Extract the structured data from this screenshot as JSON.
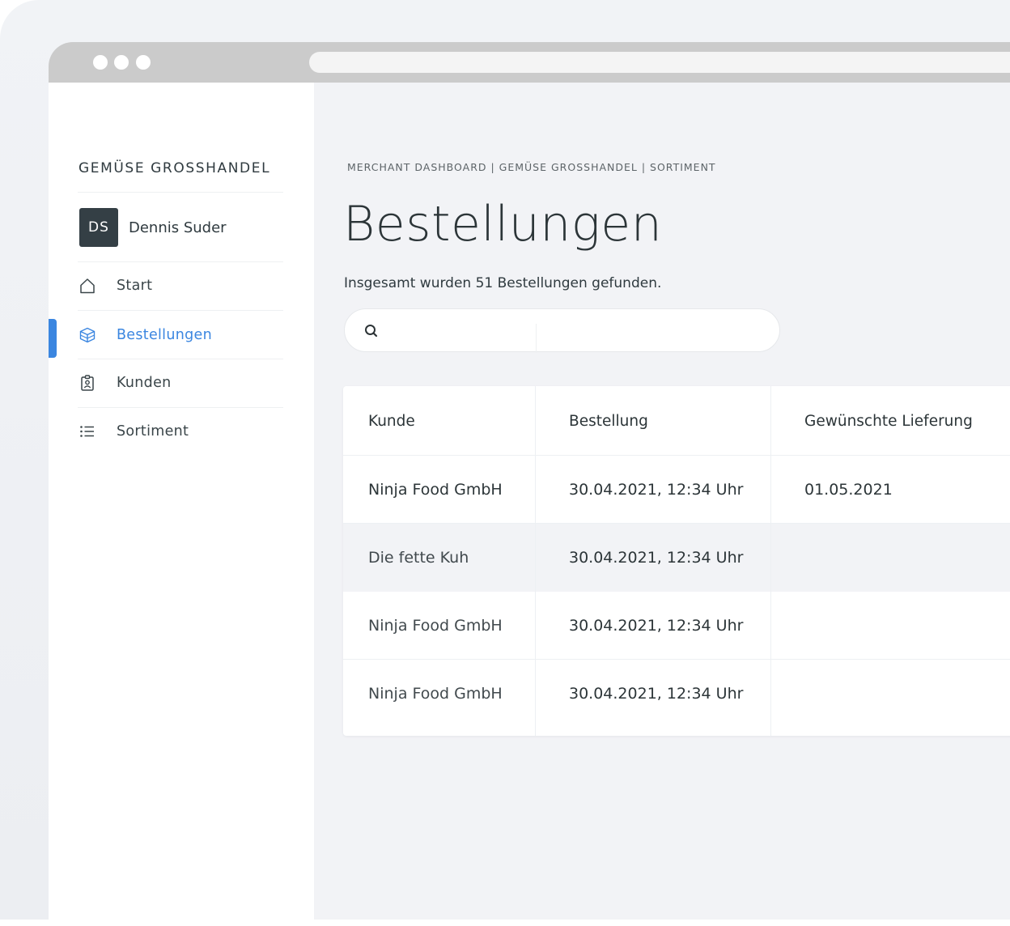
{
  "brand": "GEMÜSE GROSSHANDEL",
  "user": {
    "initials": "DS",
    "name": "Dennis Suder"
  },
  "nav": [
    {
      "label": "Start",
      "icon": "home-icon",
      "active": false
    },
    {
      "label": "Bestellungen",
      "icon": "box-icon",
      "active": true
    },
    {
      "label": "Kunden",
      "icon": "id-badge-icon",
      "active": false
    },
    {
      "label": "Sortiment",
      "icon": "list-icon",
      "active": false
    }
  ],
  "breadcrumb": "MERCHANT DASHBOARD | GEMÜSE GROSSHANDEL | SORTIMENT",
  "page_title": "Bestellungen",
  "summary": "Insgesamt wurden 51 Bestellungen gefunden.",
  "search": {
    "placeholder": "",
    "value": ""
  },
  "table": {
    "headers": [
      "Kunde",
      "Bestellung",
      "Gewünschte Lieferung"
    ],
    "rows": [
      [
        "Ninja Food GmbH",
        "30.04.2021, 12:34 Uhr",
        "01.05.2021"
      ],
      [
        "Die fette Kuh",
        "30.04.2021, 12:34 Uhr",
        ""
      ],
      [
        "Ninja Food GmbH",
        "30.04.2021, 12:34 Uhr",
        ""
      ],
      [
        "Ninja Food GmbH",
        "30.04.2021, 12:34 Uhr",
        ""
      ]
    ]
  },
  "colors": {
    "accent": "#3b86e0",
    "avatar_bg": "#343f45",
    "chrome": "#cbcbcb",
    "background": "#f2f3f6"
  }
}
